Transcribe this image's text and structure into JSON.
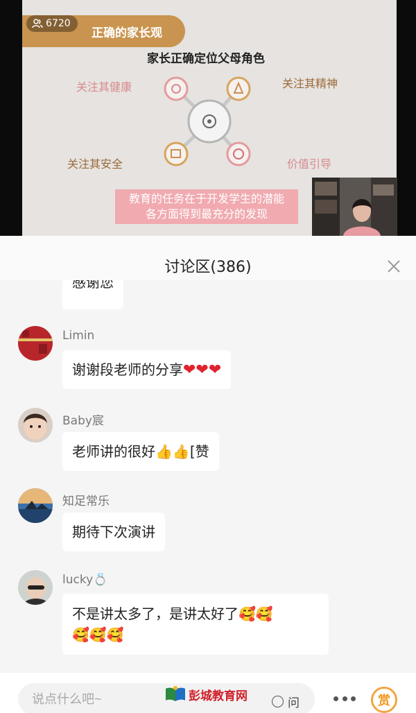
{
  "live": {
    "viewer_count": "6720",
    "slide": {
      "banner": "正确的家长观",
      "heading": "家长正确定位父母角色",
      "labels": {
        "top_left": "关注其健康",
        "top_right": "关注其精神",
        "bottom_left": "关注其安全",
        "bottom_right": "价值引导"
      },
      "caption_line1": "教育的任务在于开发学生的潜能",
      "caption_line2": "各方面得到最充分的发现"
    }
  },
  "discussion": {
    "title": "讨论区(386)",
    "messages": [
      {
        "user": "",
        "text": "感谢您",
        "partial": true
      },
      {
        "user": "Limin",
        "text": "谢谢段老师的分享",
        "emoji": "❤❤❤"
      },
      {
        "user": "Baby宸",
        "text": "老师讲的很好",
        "emoji": "👍👍",
        "trailing": "[赞"
      },
      {
        "user": "知足常乐",
        "text": "期待下次演讲"
      },
      {
        "user": "lucky💍",
        "text": "不是讲太多了，是讲太好了",
        "emoji_line1": "🥰🥰",
        "emoji_line2": "🥰🥰🥰"
      }
    ]
  },
  "bottom_bar": {
    "input_placeholder": "说点什么吧~",
    "watermark": "彭城教育网",
    "ask_label": "问",
    "reward_label": "赏"
  },
  "colors": {
    "banner": "#c9944f",
    "caption_bg": "#f0aab0",
    "reward_accent": "#f3a53f",
    "heart": "#e0242f"
  }
}
